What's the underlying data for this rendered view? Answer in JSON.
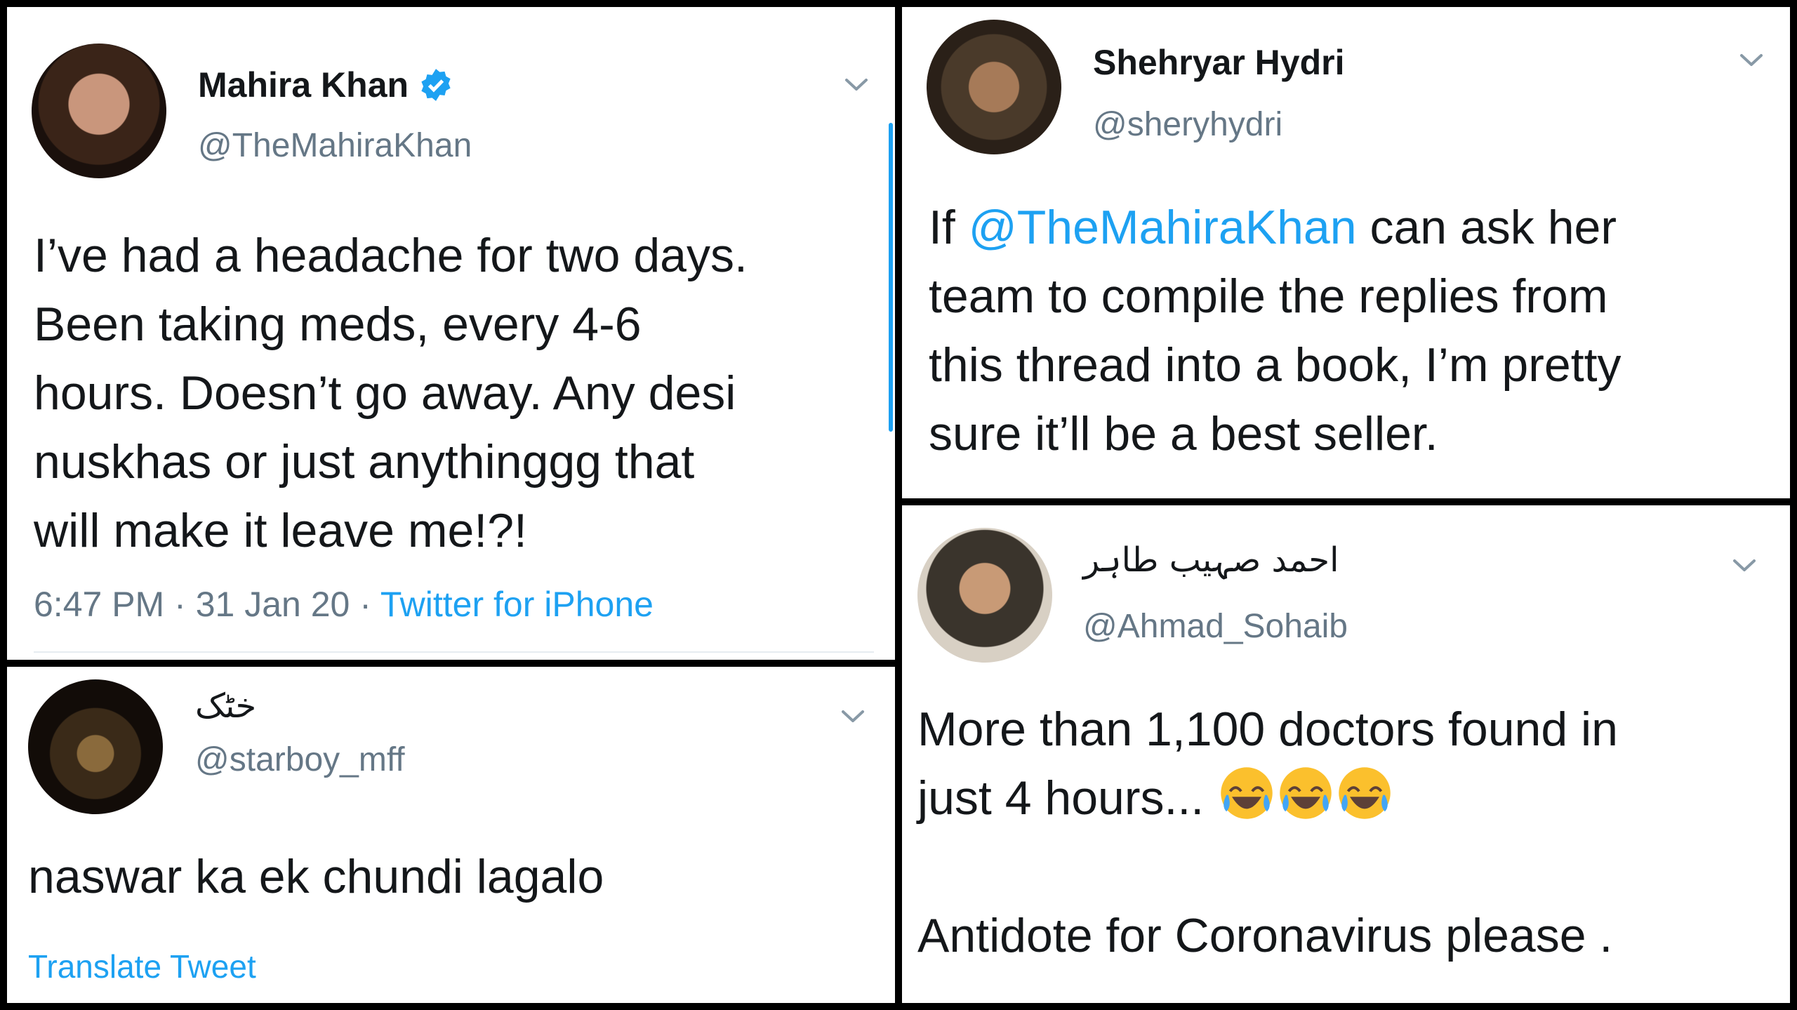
{
  "tweets": [
    {
      "name": "Mahira Khan",
      "verified": true,
      "handle": "@TheMahiraKhan",
      "lines": [
        "I’ve had a headache for two days.",
        "Been taking meds, every 4-6",
        "hours. Doesn’t go away. Any desi",
        "nuskhas or just anythinggg that",
        "will make it leave me!?!"
      ],
      "time": "6:47 PM",
      "sep": "·",
      "date": "31 Jan 20",
      "source": "Twitter for iPhone"
    },
    {
      "name": "Shehryar Hydri",
      "handle": "@sheryhydri",
      "line1_prefix": "If ",
      "line1_mention": "@TheMahiraKhan",
      "line1_suffix": " can ask her",
      "lines": [
        "team to compile the replies from",
        "this thread  into a book, I’m pretty",
        "sure it’ll be a best seller."
      ]
    },
    {
      "name": "خٹک",
      "handle": "@starboy_mff",
      "text": "naswar ka ek chundi lagalo",
      "translate": "Translate Tweet"
    },
    {
      "name": "احمد صہیب طاہر",
      "handle": "@Ahmad_Sohaib",
      "line1": "More than 1,100 doctors found in",
      "line2": "just 4 hours...",
      "emoji_name": "face-with-tears-of-joy",
      "line3": "Antidote for Coronavirus please ."
    }
  ],
  "colors": {
    "link": "#1da1f2",
    "text": "#14171a",
    "secondary": "#657786",
    "divider": "#000000",
    "emoji": "#fbc02d"
  }
}
